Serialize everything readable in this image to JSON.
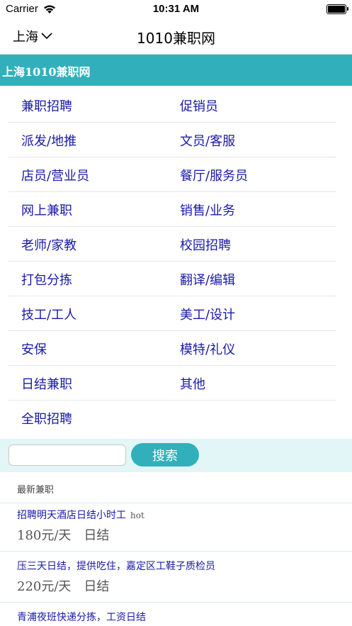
{
  "status_bar": {
    "carrier": "Carrier",
    "time": "10:31 AM"
  },
  "nav": {
    "city": "上海",
    "title": "1010兼职网"
  },
  "header": {
    "site_name": "上海1010兼职网"
  },
  "categories": [
    [
      "兼职招聘",
      "促销员"
    ],
    [
      "派发/地推",
      "文员/客服"
    ],
    [
      "店员/营业员",
      "餐厅/服务员"
    ],
    [
      "网上兼职",
      "销售/业务"
    ],
    [
      "老师/家教",
      "校园招聘"
    ],
    [
      "打包分拣",
      "翻译/编辑"
    ],
    [
      "技工/工人",
      "美工/设计"
    ],
    [
      "安保",
      "模特/礼仪"
    ],
    [
      "日结兼职",
      "其他"
    ],
    [
      "全职招聘",
      ""
    ]
  ],
  "search": {
    "placeholder": "",
    "value": "",
    "button_label": "搜索"
  },
  "latest": {
    "title": "最新兼职",
    "jobs": [
      {
        "title": "招聘明天酒店日结小时工",
        "badge": "hot",
        "pay": "180元/天",
        "settle": "日结"
      },
      {
        "title": "压三天日结，提供吃住，嘉定区工鞋子质检员",
        "badge": "",
        "pay": "220元/天",
        "settle": "日结"
      },
      {
        "title": "青浦夜班快递分拣，工资日结",
        "badge": "",
        "pay": "",
        "settle": ""
      }
    ]
  },
  "colors": {
    "accent": "#31b0bb",
    "link": "#1a1aa8",
    "search_bg": "#e2f5f7"
  },
  "icons": {
    "wifi": "wifi-icon",
    "battery": "battery-icon",
    "city_dropdown": "chevron-down-icon"
  }
}
